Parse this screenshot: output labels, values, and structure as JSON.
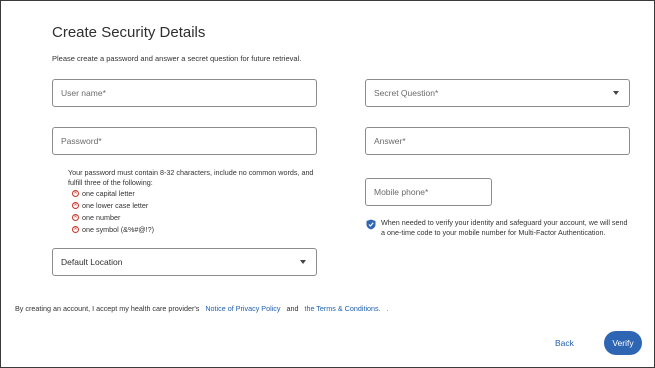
{
  "page": {
    "title": "Create Security Details",
    "subtitle": "Please create a password and answer a secret question for future retrieval."
  },
  "fields": {
    "username_placeholder": "User name*",
    "password_placeholder": "Password*",
    "default_location": "Default Location",
    "secret_question_placeholder": "Secret Question*",
    "answer_placeholder": "Answer*",
    "mobile_phone_placeholder": "Mobile phone*"
  },
  "password_rules": {
    "intro": "Your password must contain 8-32 characters, include no common words, and fulfill three of the following:",
    "items": [
      "one capital letter",
      "one lower case letter",
      "one number",
      "one symbol (&%#@!?)"
    ]
  },
  "mfa_info": "When needed to verify your identity and safeguard your account, we will send a one-time code to your mobile number for Multi-Factor Authentication.",
  "consent": {
    "prefix": "By creating an account, I accept my health care provider's",
    "privacy_link": "Notice of Privacy Policy",
    "and": "and",
    "terms_link": "the Terms & Conditions.",
    "suffix": "."
  },
  "actions": {
    "back": "Back",
    "verify": "Verify"
  },
  "colors": {
    "accent": "#2f66b3",
    "link": "#1f5fae",
    "error": "#c0392b"
  },
  "icons": {
    "rule_status": "x-circle-icon",
    "info": "shield-icon",
    "dropdown": "chevron-down-icon"
  }
}
